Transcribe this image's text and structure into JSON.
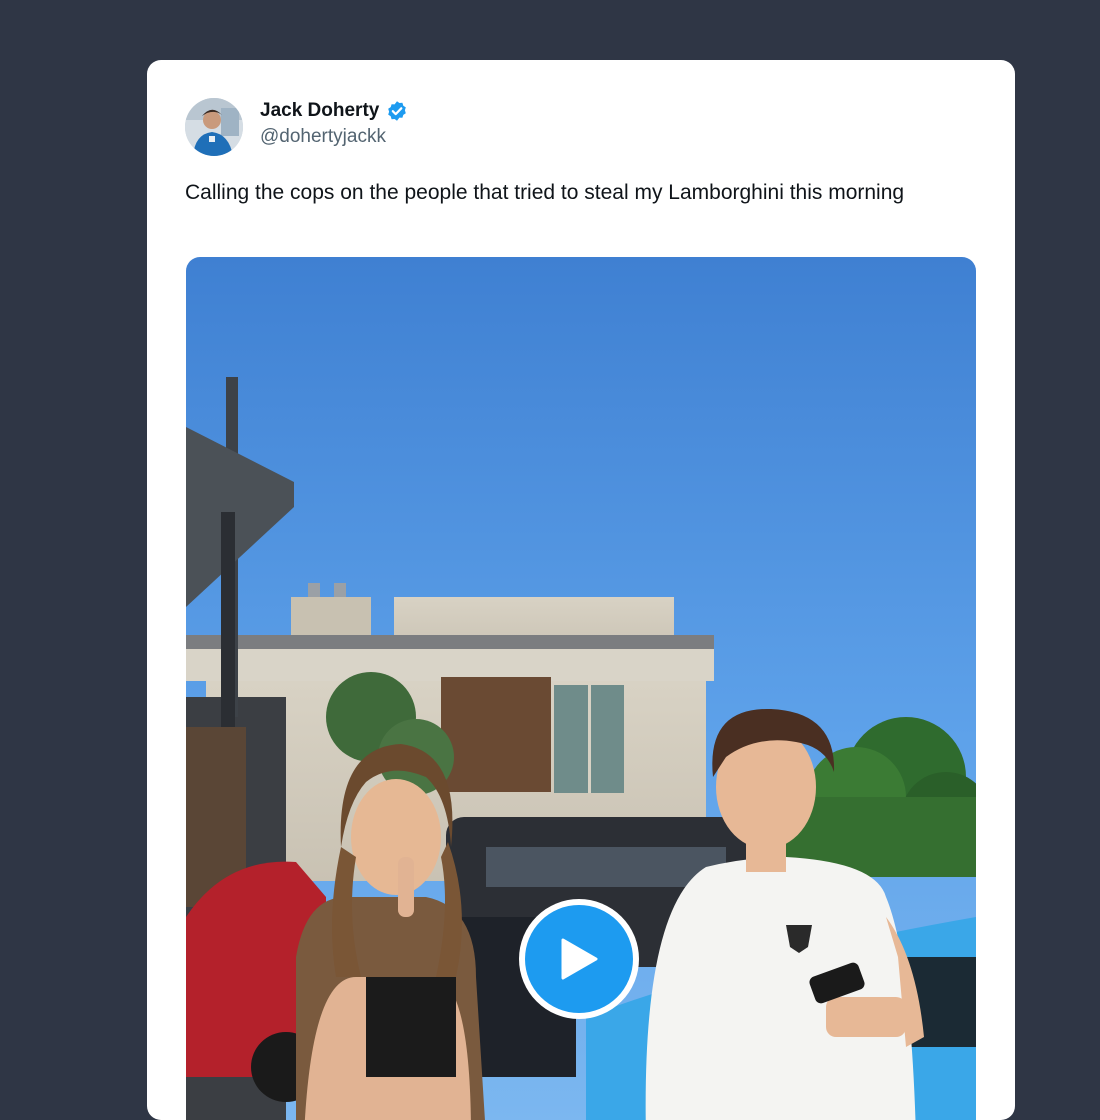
{
  "tweet": {
    "author": {
      "display_name": "Jack Doherty",
      "handle": "@dohertyjackk",
      "verified": true,
      "verified_color": "#1d9bf0"
    },
    "text": "Calling the cops on the people that tried to steal my Lamborghini this morning",
    "media": {
      "type": "video",
      "play_icon": "play-icon",
      "accent": "#1d9bf0"
    }
  },
  "colors": {
    "page_background": "#2f3645",
    "card_background": "#ffffff",
    "text_primary": "#0f1419",
    "text_secondary": "#536471"
  }
}
